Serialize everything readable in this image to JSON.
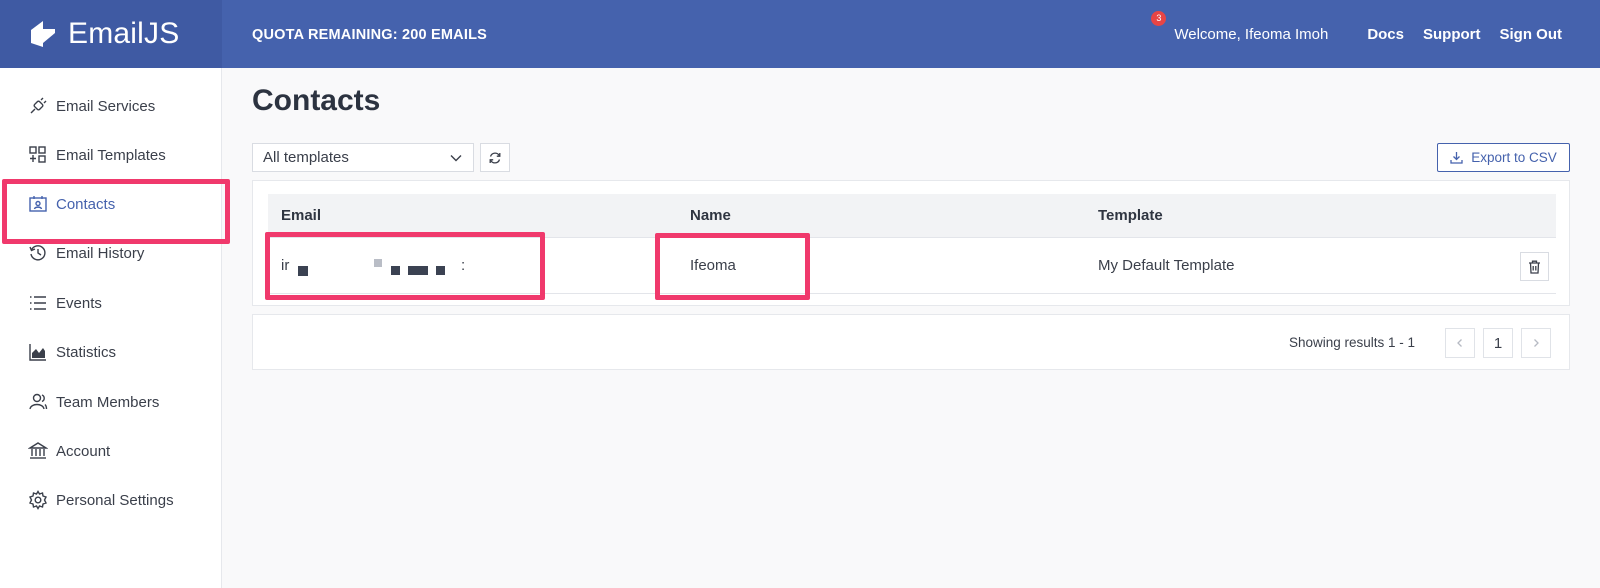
{
  "brand": {
    "name": "EmailJS",
    "icon": "emailjs-logo-icon"
  },
  "header": {
    "quota_text": "QUOTA REMAINING: 200 EMAILS",
    "notification_count": "3",
    "welcome_text": "Welcome,  Ifeoma Imoh",
    "links": {
      "docs": "Docs",
      "support": "Support",
      "sign_out": "Sign Out"
    }
  },
  "sidebar": {
    "items": [
      {
        "label": "Email Services",
        "icon": "plug-icon"
      },
      {
        "label": "Email Templates",
        "icon": "templates-icon"
      },
      {
        "label": "Contacts",
        "icon": "contact-card-icon",
        "active": true
      },
      {
        "label": "Email History",
        "icon": "history-icon"
      },
      {
        "label": "Events",
        "icon": "list-icon"
      },
      {
        "label": "Statistics",
        "icon": "area-chart-icon"
      },
      {
        "label": "Team Members",
        "icon": "team-icon"
      },
      {
        "label": "Account",
        "icon": "bank-icon"
      },
      {
        "label": "Personal Settings",
        "icon": "gear-icon"
      }
    ]
  },
  "main": {
    "title": "Contacts",
    "template_filter": {
      "selected": "All templates"
    },
    "export_label": "Export to CSV",
    "table": {
      "columns": [
        "Email",
        "Name",
        "Template"
      ],
      "rows": [
        {
          "email_prefix": "ir",
          "email_suffix": ":",
          "name": "Ifeoma",
          "template": "My Default Template"
        }
      ]
    },
    "pagination": {
      "results_text": "Showing results 1 - 1",
      "current_page": "1"
    }
  },
  "colors": {
    "header": "#4562ad",
    "brand_bg": "#3f5aa3",
    "highlight": "#f0396c",
    "accent": "#4562ad",
    "badge": "#e74545"
  }
}
